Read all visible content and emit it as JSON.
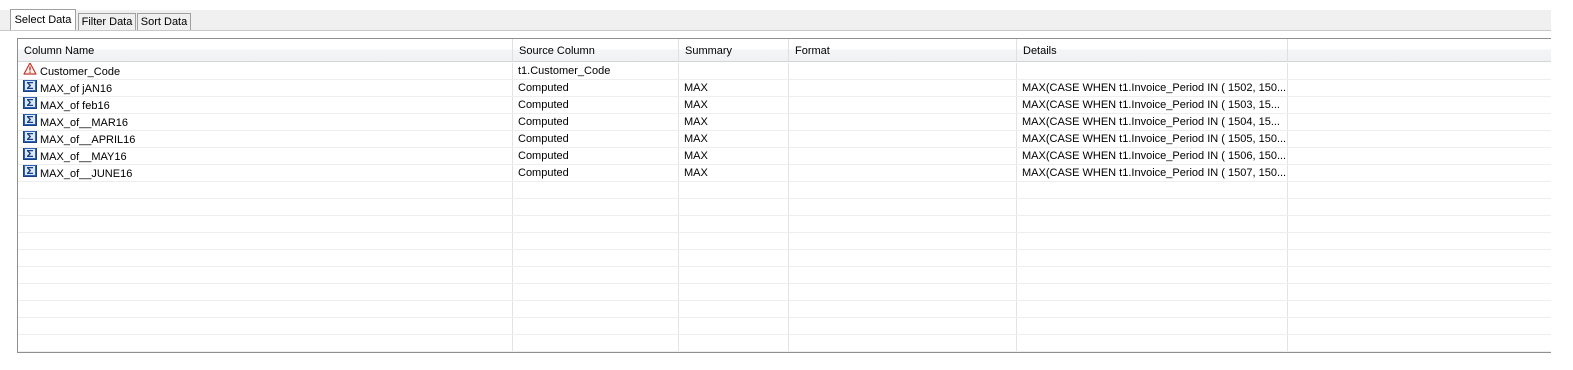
{
  "tabs": [
    {
      "label": "Select Data",
      "active": true
    },
    {
      "label": "Filter Data",
      "active": false
    },
    {
      "label": "Sort Data",
      "active": false
    }
  ],
  "columns": [
    "Column Name",
    "Source Column",
    "Summary",
    "Format",
    "Details"
  ],
  "rows": [
    {
      "icon": "warning-icon",
      "name": "Customer_Code",
      "source": "t1.Customer_Code",
      "summary": "",
      "format": "",
      "details": ""
    },
    {
      "icon": "sigma-icon",
      "name": "MAX_of jAN16",
      "source": "Computed",
      "summary": "MAX",
      "format": "",
      "details": "MAX(CASE WHEN t1.Invoice_Period IN  ( 1502, 150..."
    },
    {
      "icon": "sigma-icon",
      "name": "MAX_of feb16",
      "source": "Computed",
      "summary": "MAX",
      "format": "",
      "details": "MAX(CASE WHEN t1.Invoice_Period IN  (  1503, 15..."
    },
    {
      "icon": "sigma-icon",
      "name": "MAX_of__MAR16",
      "source": "Computed",
      "summary": "MAX",
      "format": "",
      "details": "MAX(CASE WHEN t1.Invoice_Period IN  (  1504, 15..."
    },
    {
      "icon": "sigma-icon",
      "name": "MAX_of__APRIL16",
      "source": "Computed",
      "summary": "MAX",
      "format": "",
      "details": "MAX(CASE WHEN t1.Invoice_Period IN  ( 1505, 150..."
    },
    {
      "icon": "sigma-icon",
      "name": "MAX_of__MAY16",
      "source": "Computed",
      "summary": "MAX",
      "format": "",
      "details": "MAX(CASE WHEN t1.Invoice_Period IN  ( 1506, 150..."
    },
    {
      "icon": "sigma-icon",
      "name": "MAX_of__JUNE16",
      "source": "Computed",
      "summary": "MAX",
      "format": "",
      "details": "MAX(CASE WHEN t1.Invoice_Period IN  ( 1507, 150..."
    }
  ],
  "empty_rows": 10
}
